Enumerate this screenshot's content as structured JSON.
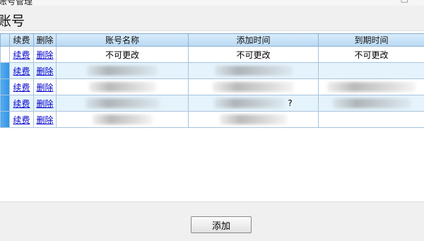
{
  "window": {
    "title": "账号管理",
    "close_glyph": "□"
  },
  "page": {
    "title": "账号"
  },
  "grid": {
    "headers": [
      "",
      "续费",
      "删除",
      "账号名称",
      "添加时间",
      "到期时间"
    ],
    "rows": [
      {
        "renew": "续费",
        "delete": "删除",
        "account": "不可更改",
        "added": "不可更改",
        "expires": "不可更改"
      },
      {
        "renew": "续费",
        "delete": "删除",
        "account": "",
        "added": "",
        "expires": ""
      },
      {
        "renew": "续费",
        "delete": "删除",
        "account": "",
        "added": "",
        "expires": ""
      },
      {
        "renew": "续费",
        "delete": "删除",
        "account": "",
        "added": "?",
        "expires": ""
      },
      {
        "renew": "续费",
        "delete": "删除",
        "account": "",
        "added": "",
        "expires": ""
      }
    ]
  },
  "footer": {
    "add_label": "添加"
  },
  "colors": {
    "header_bg": "#c6e1f7",
    "selected_col": "#3a9ae9",
    "alt_row": "#e5f3fc",
    "link": "#0000cc"
  }
}
